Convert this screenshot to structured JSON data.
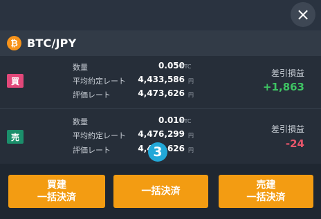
{
  "close_label": "×",
  "header": {
    "coin_symbol": "₿",
    "pair": "BTC/JPY"
  },
  "positions": [
    {
      "side": "買",
      "side_color": "#e2487a",
      "qty_label": "数量",
      "qty_value": "0.050",
      "qty_unit": "BTC",
      "avg_label": "平均約定レート",
      "avg_value": "4,433,586",
      "avg_unit": "円",
      "eval_label": "評価レート",
      "eval_value": "4,473,626",
      "eval_unit": "円",
      "pl_label": "差引損益",
      "pl_value": "+1,863",
      "pl_color": "#3ec463"
    },
    {
      "side": "売",
      "side_color": "#1b8f6b",
      "qty_label": "数量",
      "qty_value": "0.010",
      "qty_unit": "BTC",
      "avg_label": "平均約定レート",
      "avg_value": "4,476,299",
      "avg_unit": "円",
      "eval_label": "評価レート",
      "eval_value": "4,473,626",
      "eval_unit": "円",
      "pl_label": "差引損益",
      "pl_value": "-24",
      "pl_color": "#e8566b"
    }
  ],
  "step_marker": "3",
  "buttons": {
    "close_buy": "買建\n一括決済",
    "close_all": "一括決済",
    "close_sell": "売建\n一括決済"
  },
  "accent_color": "#f39c12"
}
